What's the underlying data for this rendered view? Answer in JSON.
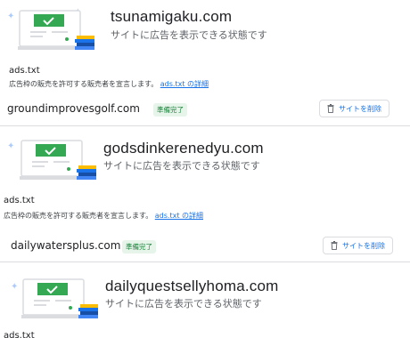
{
  "cards": [
    {
      "domain": "tsunamigaku.com",
      "status": "サイトに広告を表示できる状態です",
      "ads_title": "ads.txt",
      "ads_desc": "広告枠の販売を許可する販売者を宣言します。",
      "ads_link": "ads.txt の詳細",
      "site_name": "groundimprovesgolf.com",
      "badge": "準備完了",
      "delete_label": "サイトを削除"
    },
    {
      "domain": "godsdinkerenedyu.com",
      "status": "サイトに広告を表示できる状態です",
      "ads_title": "ads.txt",
      "ads_desc": "広告枠の販売を許可する販売者を宣言します。",
      "ads_link": "ads.txt の詳細",
      "site_name": "dailywatersplus.com",
      "badge": "準備完了",
      "delete_label": "サイトを削除"
    },
    {
      "domain": "dailyquestsellyhoma.com",
      "status": "サイトに広告を表示できる状態です",
      "ads_title": "ads.txt"
    }
  ],
  "colors": {
    "accent": "#1a73e8",
    "badge_text": "#188038",
    "badge_bg": "#e6f4ea",
    "check_green": "#34a853",
    "divider": "#dadce0"
  },
  "icons": {
    "illustration": "laptop-check-illustration",
    "trash": "trash-icon"
  }
}
